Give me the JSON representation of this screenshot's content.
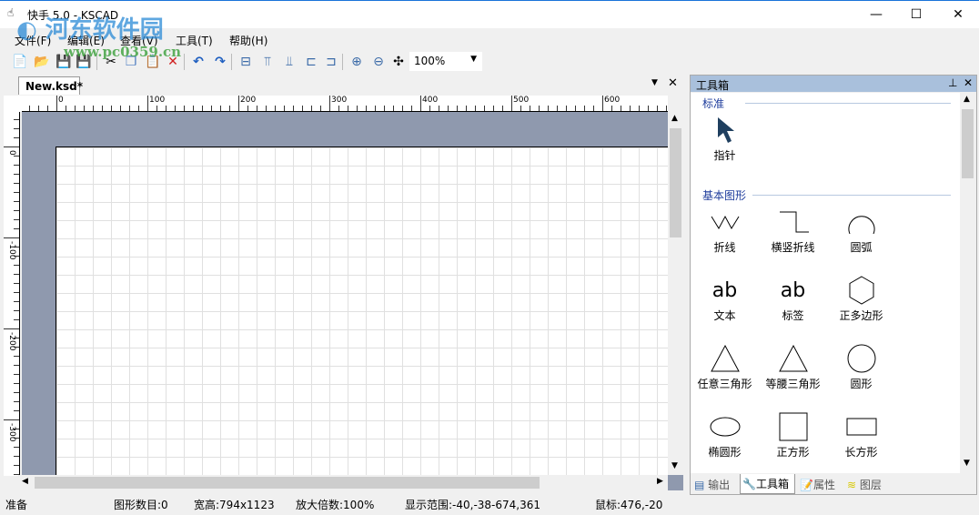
{
  "window": {
    "title": "快手 5.0 - KSCAD",
    "minimize": "—",
    "maximize": "☐",
    "close": "✕"
  },
  "watermark": {
    "name": "河东软件园",
    "url": "www.pc0359.cn"
  },
  "menu": [
    "文件(F)",
    "编辑(E)",
    "查看(V)",
    "工具(T)",
    "帮助(H)"
  ],
  "toolbar": {
    "zoom_value": "100%"
  },
  "document": {
    "tab": "New.ksd*",
    "hruler": [
      "0",
      "100",
      "200",
      "300",
      "400",
      "500",
      "600"
    ],
    "vruler": [
      "0",
      "-100",
      "-200",
      "-300"
    ]
  },
  "toolbox": {
    "title": "工具箱",
    "sections": [
      {
        "title": "标准",
        "tools": [
          {
            "label": "指针",
            "icon": "pointer"
          }
        ]
      },
      {
        "title": "基本图形",
        "tools": [
          {
            "label": "折线",
            "icon": "polyline"
          },
          {
            "label": "横竖折线",
            "icon": "ortho-polyline"
          },
          {
            "label": "圆弧",
            "icon": "arc"
          },
          {
            "label": "文本",
            "icon": "text"
          },
          {
            "label": "标签",
            "icon": "label"
          },
          {
            "label": "正多边形",
            "icon": "polygon"
          },
          {
            "label": "任意三角形",
            "icon": "triangle"
          },
          {
            "label": "等腰三角形",
            "icon": "isosceles-triangle"
          },
          {
            "label": "圆形",
            "icon": "circle"
          },
          {
            "label": "椭圆形",
            "icon": "ellipse"
          },
          {
            "label": "正方形",
            "icon": "square"
          },
          {
            "label": "长方形",
            "icon": "rectangle"
          }
        ]
      }
    ],
    "ab": "ab",
    "tabs": [
      "输出",
      "工具箱",
      "属性",
      "图层"
    ]
  },
  "status": {
    "ready": "准备",
    "count": "图形数目:0",
    "size": "宽高:794x1123",
    "zoom": "放大倍数:100%",
    "range": "显示范围:-40,-38-674,361",
    "mouse": "鼠标:476,-20"
  }
}
